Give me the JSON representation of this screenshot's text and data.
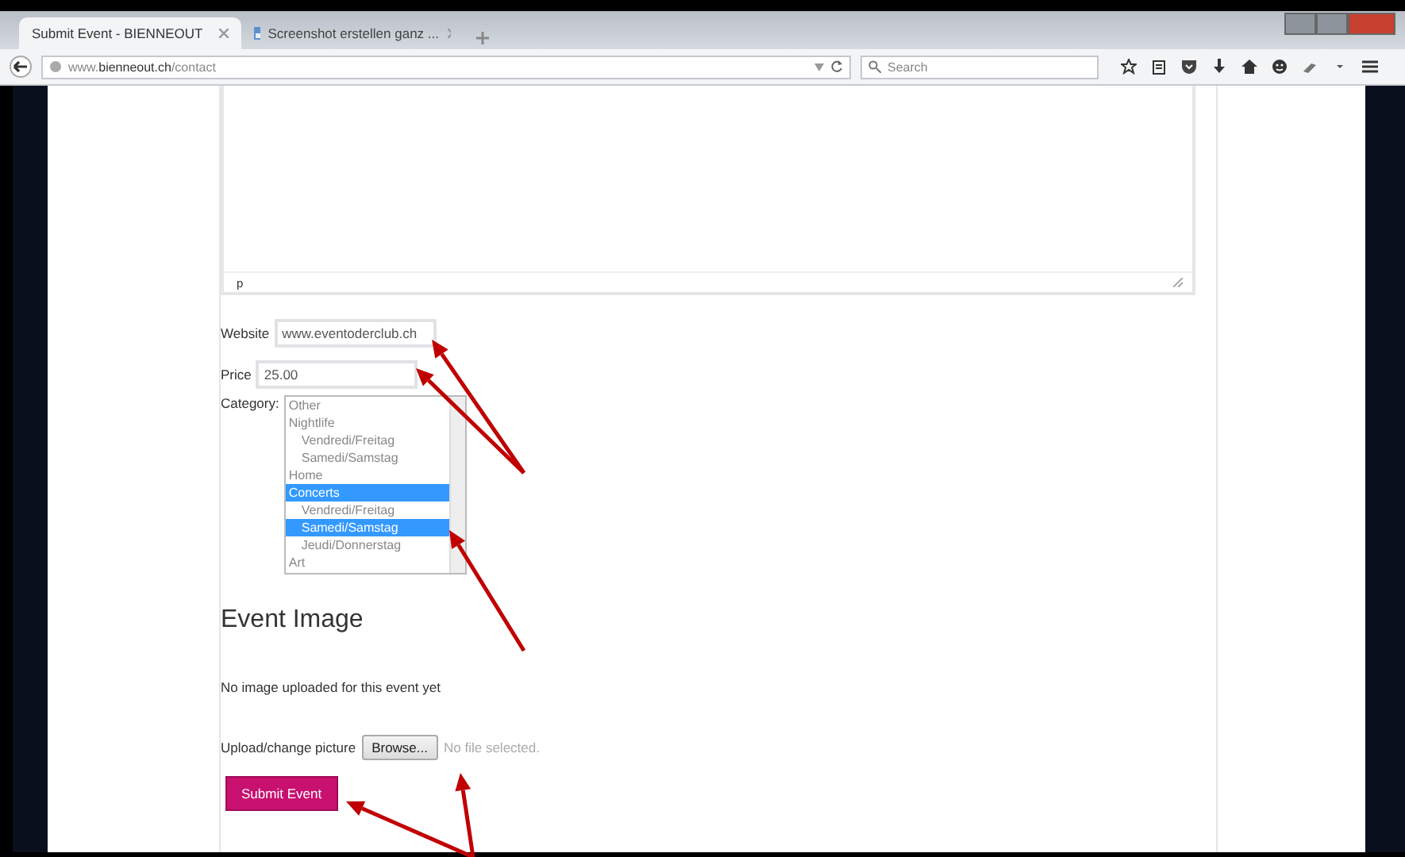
{
  "tabs": [
    {
      "title": "Submit Event - BIENNEOUT",
      "selected": true
    },
    {
      "title": "Screenshot erstellen ganz ...",
      "selected": false
    }
  ],
  "address_bar": {
    "url": "www.**bienneout.ch**/contact"
  },
  "search": {
    "placeholder": "Search"
  },
  "editor": {
    "status_path": "p"
  },
  "form": {
    "website": {
      "label": "Website",
      "value": "www.eventoderclub.ch"
    },
    "price": {
      "label": "Price",
      "value": "25.00"
    },
    "category": {
      "label": "Category:",
      "options": [
        {
          "label": "Other",
          "selected": false
        },
        {
          "label": "Nightlife",
          "selected": false,
          "children": [
            {
              "label": "Vendredi/Freitag",
              "selected": false
            },
            {
              "label": "Samedi/Samstag",
              "selected": false
            }
          ]
        },
        {
          "label": "Home",
          "selected": false
        },
        {
          "label": "Concerts",
          "selected": true,
          "children": [
            {
              "label": "Vendredi/Freitag",
              "selected": false
            },
            {
              "label": "Samedi/Samstag",
              "selected": true
            },
            {
              "label": "Jeudi/Donnerstag",
              "selected": false
            }
          ]
        },
        {
          "label": "Art",
          "selected": false
        }
      ]
    }
  },
  "event_image": {
    "heading": "Event Image",
    "status": "No image uploaded for this event yet",
    "upload_label": "Upload/change picture",
    "browse_button": "Browse...",
    "file_status": "No file selected."
  },
  "submit_button": "Submit Event"
}
